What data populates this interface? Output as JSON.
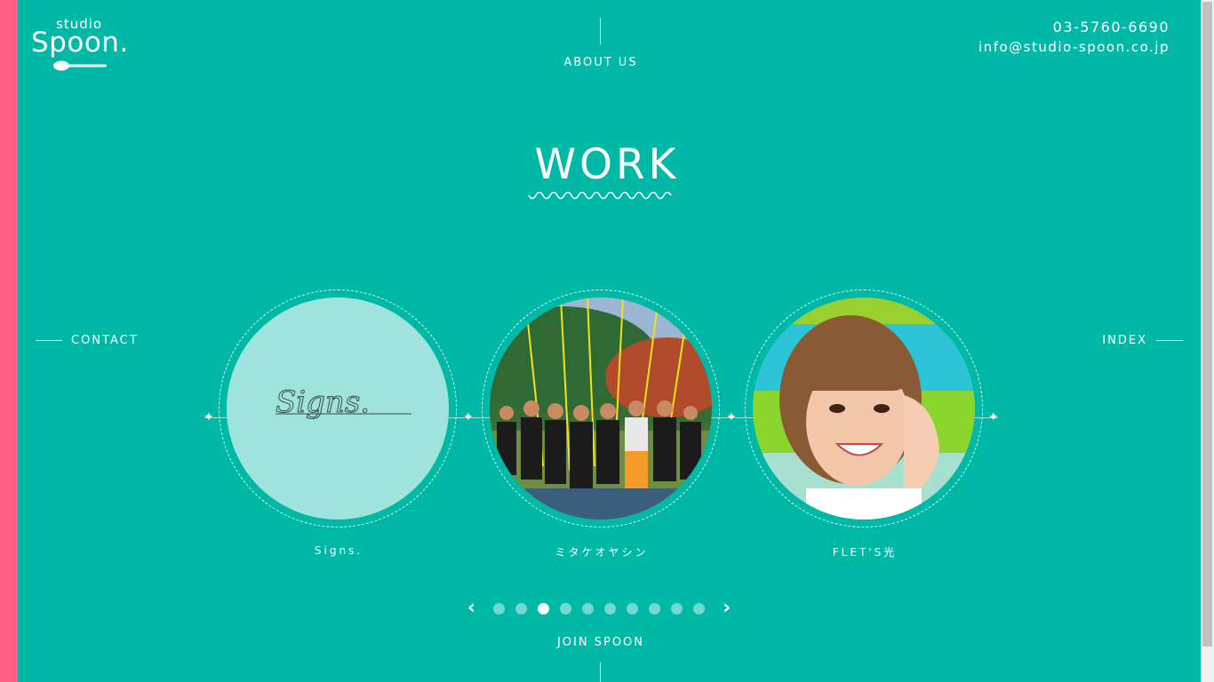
{
  "brand": {
    "logo_small": "studio",
    "logo_main": "Spoon."
  },
  "header": {
    "nav_about": "ABOUT US",
    "phone": "03-5760-6690",
    "email": "info@studio-spoon.co.jp"
  },
  "main": {
    "title": "WORK",
    "nav_contact": "CONTACT",
    "nav_index": "INDEX",
    "works": [
      {
        "caption": "Signs.",
        "disc_text": "Signs."
      },
      {
        "caption": "ミタケオヤシン"
      },
      {
        "caption": "FLET'S光"
      }
    ],
    "pager": {
      "total": 10,
      "active_index": 3
    },
    "join_link": "JOIN SPOON"
  },
  "colors": {
    "background": "#00b8a6",
    "accent_bar": "#ff5d85",
    "text": "#ffffff",
    "signs_disc": "#9ee3dc"
  },
  "icons": [
    "spoon-icon",
    "chevron-left-icon",
    "chevron-right-icon",
    "diamond-node-icon"
  ]
}
